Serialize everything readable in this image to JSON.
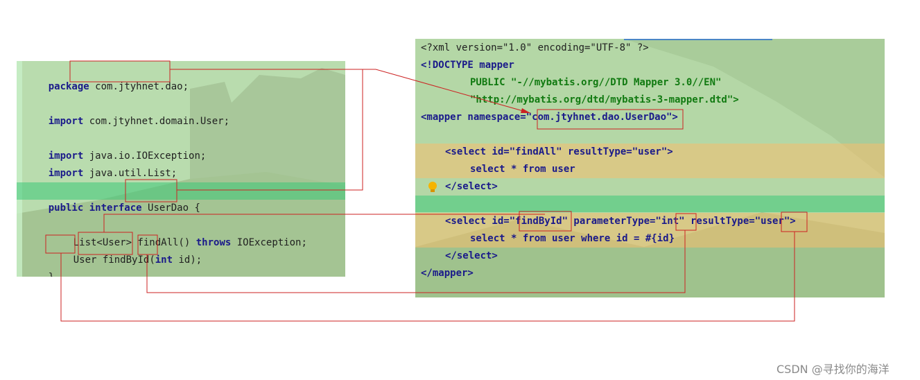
{
  "java_editor": {
    "lines": [
      [
        "package",
        "com.jtyhnet.dao;"
      ],
      [
        "import",
        "com.jtyhnet.domain.User;"
      ],
      [
        "import",
        "java.io.IOException;"
      ],
      [
        "import",
        "java.util.List;"
      ],
      [
        "public interface",
        "UserDao",
        "{"
      ],
      [
        "List<User> findAll() ",
        "throws",
        " IOException;"
      ],
      [
        "User",
        "findById",
        "(",
        "int",
        " id);"
      ],
      [
        "}"
      ]
    ]
  },
  "xml_editor": {
    "lines": [
      "<?xml version=\"1.0\" encoding=\"UTF-8\" ?>",
      "<!DOCTYPE mapper",
      "PUBLIC \"-//mybatis.org//DTD Mapper 3.0//EN\"",
      "\"http://mybatis.org/dtd/mybatis-3-mapper.dtd\">",
      "<mapper namespace=\"com.jtyhnet.dao.UserDao\">",
      "<select id=\"findAll\" resultType=\"user\">",
      "select * from user",
      "</select>",
      "<select id=\"findById\" parameterType=\"int\" resultType=\"user\">",
      "select * from user where id = #{id}",
      "</select>",
      "</mapper>"
    ]
  },
  "icons": {
    "bulb": "lightbulb-icon"
  },
  "colors": {
    "annotation": "#cc2222",
    "line_highlight": "#3cc878",
    "block_highlight": "#f5be6e"
  },
  "watermark": "CSDN @寻找你的海洋"
}
